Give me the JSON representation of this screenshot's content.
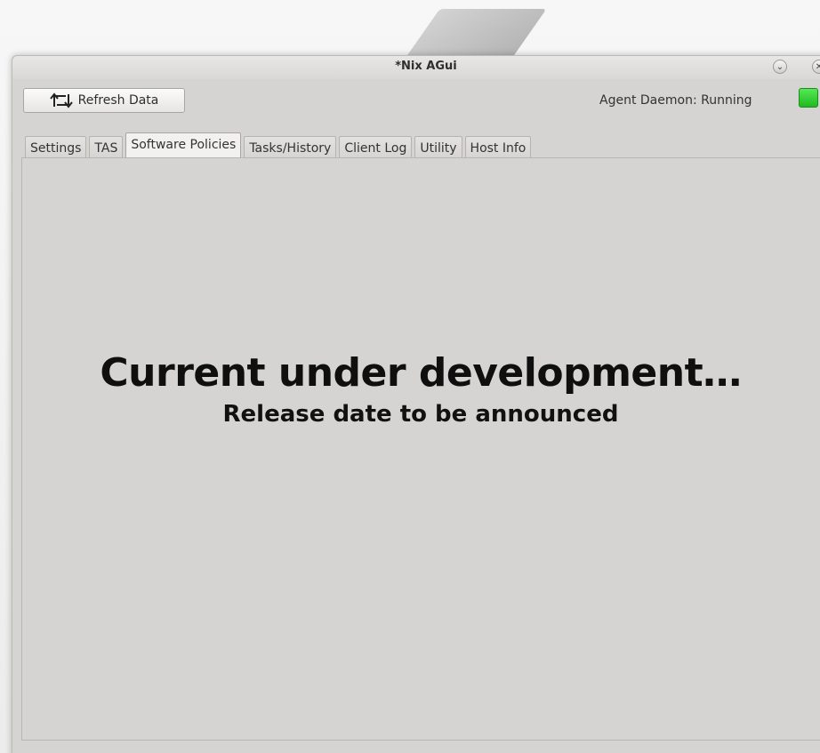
{
  "window": {
    "title": "*Nix AGui",
    "minimize_glyph": "⌄",
    "close_glyph": "✕"
  },
  "toolbar": {
    "refresh_label": "Refresh Data",
    "refresh_icon": "refresh-icon"
  },
  "status": {
    "daemon_text": "Agent Daemon: Running",
    "indicator_color": "#2bd12b"
  },
  "tabs": [
    {
      "label": "Settings",
      "active": false
    },
    {
      "label": "TAS",
      "active": false
    },
    {
      "label": "Software Policies",
      "active": true
    },
    {
      "label": "Tasks/History",
      "active": false
    },
    {
      "label": "Client Log",
      "active": false
    },
    {
      "label": "Utility",
      "active": false
    },
    {
      "label": "Host Info",
      "active": false
    }
  ],
  "content": {
    "headline": "Current under development…",
    "subline": "Release date to be announced"
  }
}
